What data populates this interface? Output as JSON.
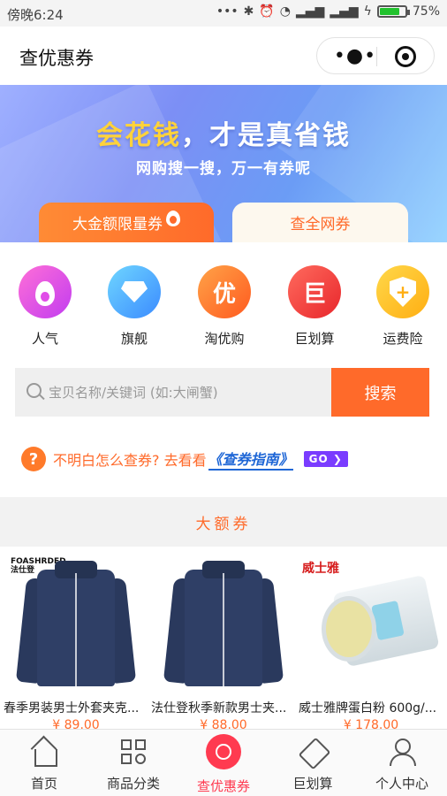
{
  "status_bar": {
    "time": "傍晚6:24",
    "battery": "75%",
    "battery_level": 0.75
  },
  "header": {
    "title": "查优惠券"
  },
  "banner": {
    "headline_highlight": "会花钱",
    "headline_rest": "，才是真省钱",
    "subline": "网购搜一搜，万一有券呢",
    "tabs": [
      "大金额限量券",
      "查全网券"
    ],
    "flame_badge": "爆"
  },
  "categories": [
    {
      "label": "人气",
      "icon": "flame-icon"
    },
    {
      "label": "旗舰",
      "icon": "diamond-icon"
    },
    {
      "label": "淘优购",
      "icon": "you-badge-icon",
      "glyph": "优"
    },
    {
      "label": "巨划算",
      "icon": "ju-badge-icon",
      "glyph": "巨"
    },
    {
      "label": "运费险",
      "icon": "shield-plus-icon"
    }
  ],
  "search": {
    "placeholder": "宝贝名称/关键词 (如:大闸蟹)",
    "button": "搜索"
  },
  "guide": {
    "prefix": "不明白怎么查券?  去看看",
    "link": "《查券指南》",
    "go": "GO"
  },
  "section": {
    "title": "大额券"
  },
  "products": [
    {
      "name": "春季男装男士外套夹克...",
      "price": "¥ 89.00",
      "brand": "FOASHRDED\n法仕登"
    },
    {
      "name": "法仕登秋季新款男士夹...",
      "price": "¥ 88.00",
      "brand": ""
    },
    {
      "name": "威士雅牌蛋白粉 600g/...",
      "price": "¥ 178.00",
      "brand": "威士雅"
    }
  ],
  "tabbar": [
    {
      "label": "首页",
      "icon": "home-icon"
    },
    {
      "label": "商品分类",
      "icon": "grid-search-icon"
    },
    {
      "label": "查优惠券",
      "icon": "coupon-search-icon",
      "active": true
    },
    {
      "label": "巨划算",
      "icon": "tag-icon"
    },
    {
      "label": "个人中心",
      "icon": "user-icon"
    }
  ],
  "colors": {
    "accent": "#ff6a2a",
    "active_tab": "#ff3a50",
    "link": "#1e66d6"
  }
}
